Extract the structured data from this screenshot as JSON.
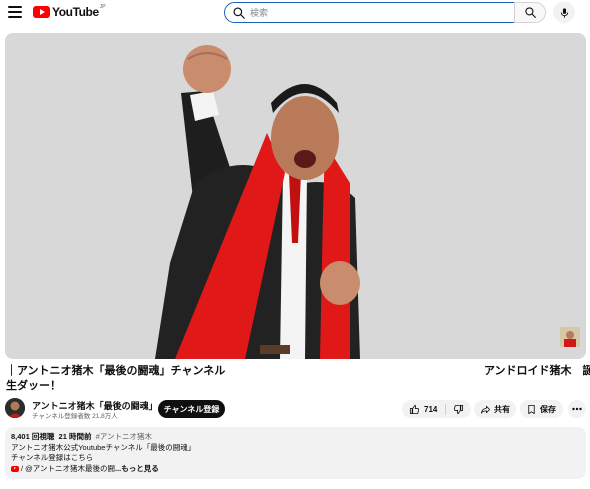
{
  "masthead": {
    "logo_text": "YouTube",
    "logo_country": "JP",
    "search_placeholder": "検索"
  },
  "video": {
    "title_left": "｜アントニオ猪木「最後の闘魂」チャンネル",
    "title_right": "アンドロイド猪木　誕",
    "title_line2": "生ダッー！"
  },
  "channel": {
    "name": "アントニオ猪木「最後の闘魂」",
    "subscribers": "チャンネル登録者数 21.8万人",
    "subscribe_label": "チャンネル登録"
  },
  "actions": {
    "like_count": "714",
    "share_label": "共有",
    "save_label": "保存"
  },
  "description": {
    "views": "8,401 回視聴",
    "time": "21 時間前",
    "hashtag": "#アントニオ猪木",
    "line2": "アントニオ猪木公式Youtubeチャンネル「最後の闘魂」",
    "line3": "チャンネル登録はこちら",
    "line4_prefix": "/ @アントニオ猪木最後の闘",
    "line4_more": "...もっと見る"
  },
  "colors": {
    "brand_red": "#ff0000",
    "search_border": "#1c62b9",
    "subscribe_bg": "#0f0f0f",
    "pill_bg": "#f2f2f2"
  }
}
